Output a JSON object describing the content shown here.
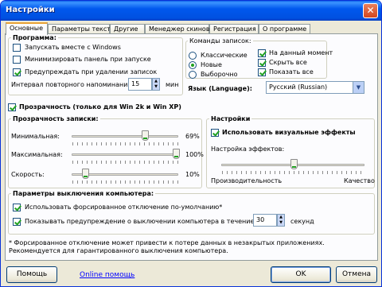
{
  "window": {
    "title": "Настройки",
    "close_glyph": "✕"
  },
  "tabs": [
    {
      "label": "Основные",
      "active": true
    },
    {
      "label": "Параметры текста",
      "active": false
    },
    {
      "label": "Другие",
      "active": false
    },
    {
      "label": "Менеджер скинов",
      "active": false
    },
    {
      "label": "Регистрация",
      "active": false
    },
    {
      "label": "О программе",
      "active": false
    }
  ],
  "program": {
    "title": "Программа:",
    "startup_with_windows": {
      "label": "Запускать вместе с Windows",
      "checked": false
    },
    "minimize_on_start": {
      "label": "Минимизировать панель при запуске",
      "checked": false
    },
    "warn_on_delete": {
      "label": "Предупреждать при удалении записок",
      "checked": true
    },
    "remind_interval": {
      "label": "Интервал повторного напоминания",
      "value": "15",
      "unit": "мин"
    }
  },
  "commands": {
    "title": "Команды записок:",
    "radios": [
      {
        "label": "Классические",
        "checked": false
      },
      {
        "label": "Новые",
        "checked": true
      },
      {
        "label": "Выборочно",
        "checked": false
      }
    ],
    "checks": [
      {
        "label": "На данный момент",
        "checked": true
      },
      {
        "label": "Скрыть все",
        "checked": true
      },
      {
        "label": "Показать все",
        "checked": true
      }
    ]
  },
  "language": {
    "label": "Язык (Language):",
    "value": "Русский (Russian)"
  },
  "transparency": {
    "label": "Прозрачность (только для Win 2k и Win XP)",
    "checked": true
  },
  "note_transparency": {
    "title": "Прозрачность записки:",
    "sliders": [
      {
        "label": "Минимальная:",
        "value": "69%",
        "level": 0.69
      },
      {
        "label": "Максимальная:",
        "value": "100%",
        "level": 1.0
      },
      {
        "label": "Скорость:",
        "value": "10%",
        "level": 0.1
      }
    ]
  },
  "settings": {
    "title": "Настройки",
    "visual_effects": {
      "label": "Использовать визуальные эффекты",
      "checked": true
    },
    "effects_label": "Настройка эффектов:",
    "effects_level": 0.5,
    "left_caption": "Производительность",
    "right_caption": "Качество"
  },
  "shutdown": {
    "title": "Параметры выключения компьютера:",
    "force_shutdown": {
      "label": "Использовать форсированное отключение по-умолчанию*",
      "checked": true
    },
    "show_warning": {
      "label": "Показывать предупреждение о выключении компьютера в течение",
      "checked": true,
      "value": "30",
      "unit": "секунд"
    }
  },
  "footnote": "* Форсированное отключение может привести к потере данных в незакрытых приложениях. Рекомендуется для гарантированного выключения компьютера.",
  "footer": {
    "help": "Помощь",
    "online_help": "Online помощь",
    "ok": "OK",
    "cancel": "Отмена"
  }
}
